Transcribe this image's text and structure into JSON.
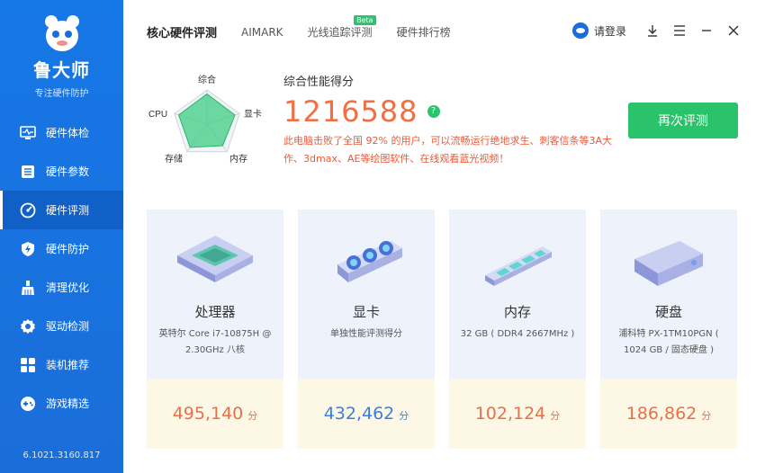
{
  "sidebar": {
    "brand": "鲁大师",
    "slogan": "专注硬件防护",
    "items": [
      {
        "label": "硬件体检",
        "icon": "monitor-pulse-icon"
      },
      {
        "label": "硬件参数",
        "icon": "sliders-icon"
      },
      {
        "label": "硬件评测",
        "icon": "gauge-icon",
        "active": true
      },
      {
        "label": "硬件防护",
        "icon": "shield-bolt-icon"
      },
      {
        "label": "清理优化",
        "icon": "broom-icon"
      },
      {
        "label": "驱动检测",
        "icon": "gear-icon"
      },
      {
        "label": "装机推荐",
        "icon": "puzzle-icon"
      },
      {
        "label": "游戏精选",
        "icon": "gamepad-icon"
      }
    ],
    "version": "6.1021.3160.817"
  },
  "header": {
    "tabs": [
      {
        "label": "核心硬件评测",
        "active": true
      },
      {
        "label": "AIMARK"
      },
      {
        "label": "光线追踪评测",
        "badge": "Beta"
      },
      {
        "label": "硬件排行榜"
      }
    ],
    "login_label": "请登录"
  },
  "summary": {
    "title": "综合性能得分",
    "score": "1216588",
    "help": "?",
    "description": "此电脑击败了全国 92% 的用户，可以流畅运行绝地求生、刺客信条等3A大作、3dmax、AE等绘图软件、在线观看蓝光视频！",
    "retest_label": "再次评测",
    "radar": {
      "labels": [
        "综合",
        "显卡",
        "内存",
        "存储",
        "CPU"
      ],
      "values": [
        0.88,
        0.86,
        0.78,
        0.84,
        0.87
      ]
    }
  },
  "cards": [
    {
      "name": "处理器",
      "desc": "英特尔 Core i7-10875H @ 2.30GHz 八核",
      "score": "495,140",
      "unit": "分",
      "color": "#e8704a"
    },
    {
      "name": "显卡",
      "desc": "单独性能评测得分",
      "score": "432,462",
      "unit": "分",
      "color": "#3a7fe0"
    },
    {
      "name": "内存",
      "desc": "32 GB ( DDR4 2667MHz )",
      "score": "102,124",
      "unit": "分",
      "color": "#e8704a"
    },
    {
      "name": "硬盘",
      "desc": "浦科特 PX-1TM10PGN ( 1024 GB / 固态硬盘 )",
      "score": "186,862",
      "unit": "分",
      "color": "#e8704a"
    }
  ],
  "colors": {
    "accent": "#1a6ed9",
    "score": "#f07044",
    "green": "#2ac26a"
  }
}
